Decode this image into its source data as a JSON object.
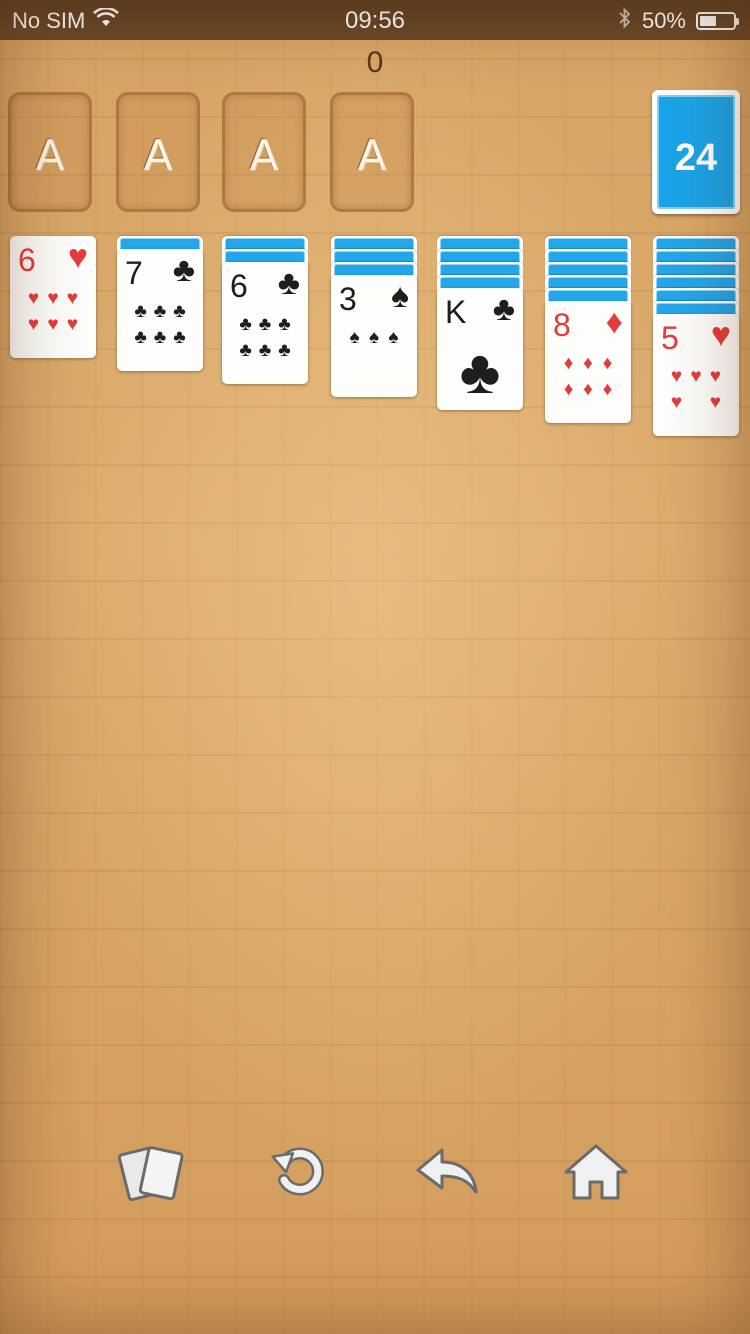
{
  "status_bar": {
    "carrier": "No SIM",
    "time": "09:56",
    "battery": "50%",
    "battery_level": 0.5,
    "icons": [
      "wifi-icon",
      "bluetooth-icon",
      "battery-icon"
    ]
  },
  "score": "0",
  "foundations": [
    "A",
    "A",
    "A",
    "A"
  ],
  "stock": {
    "count": "24"
  },
  "tableau": [
    {
      "hidden": 0,
      "card": {
        "rank": "6",
        "suit": "♥",
        "color": "red",
        "pips": [
          "♥",
          "♥",
          "♥",
          "♥",
          "♥",
          "♥"
        ]
      }
    },
    {
      "hidden": 1,
      "card": {
        "rank": "7",
        "suit": "♣",
        "color": "black",
        "pips": [
          "♣",
          "♣",
          "♣",
          "♣",
          "♣",
          "♣"
        ]
      }
    },
    {
      "hidden": 2,
      "card": {
        "rank": "6",
        "suit": "♣",
        "color": "black",
        "pips": [
          "♣",
          "♣",
          "♣",
          "♣",
          "♣",
          "♣"
        ]
      }
    },
    {
      "hidden": 3,
      "card": {
        "rank": "3",
        "suit": "♠",
        "color": "black",
        "pips": [
          "♠",
          "♠",
          "♠"
        ]
      }
    },
    {
      "hidden": 4,
      "card": {
        "rank": "K",
        "suit": "♣",
        "color": "black",
        "pips": []
      }
    },
    {
      "hidden": 5,
      "card": {
        "rank": "8",
        "suit": "♦",
        "color": "red",
        "pips": [
          "♦",
          "♦",
          "♦",
          "♦",
          "♦",
          "♦"
        ]
      }
    },
    {
      "hidden": 6,
      "card": {
        "rank": "5",
        "suit": "♥",
        "color": "red",
        "pips": [
          "♥",
          "♥",
          "♥",
          "♥",
          "♥"
        ]
      }
    }
  ],
  "toolbar": {
    "items": [
      "new-deal-icon",
      "restart-icon",
      "undo-icon",
      "home-icon"
    ]
  },
  "colors": {
    "card_back": "#23a6ea",
    "red_suit": "#e33c3c",
    "black_suit": "#1e1e1e",
    "wood": "#d9a867"
  }
}
